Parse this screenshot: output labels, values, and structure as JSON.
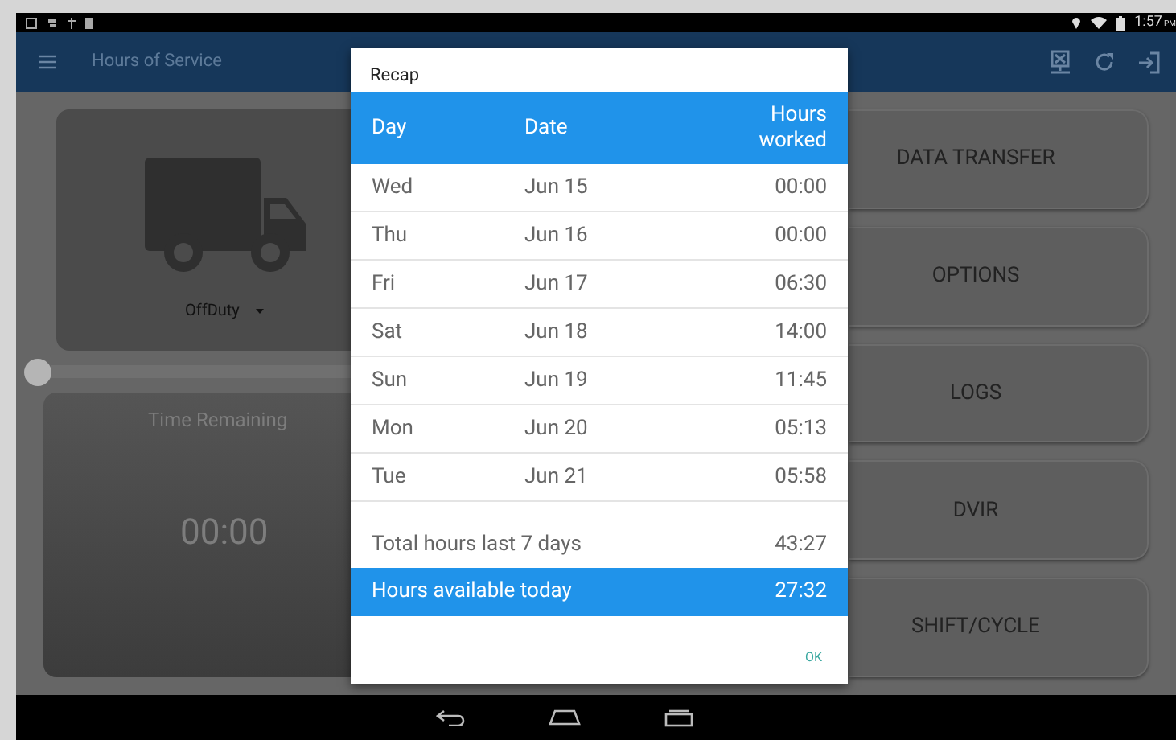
{
  "status_bar": {
    "time": "1:57",
    "ampm": "PM"
  },
  "app_bar": {
    "title": "Hours of Service"
  },
  "status_card": {
    "status": "OffDuty"
  },
  "time_card": {
    "label": "Time Remaining",
    "value": "00:00"
  },
  "menu_buttons": [
    "DATA TRANSFER",
    "OPTIONS",
    "LOGS",
    "DVIR",
    "SHIFT/CYCLE"
  ],
  "dialog": {
    "title": "Recap",
    "columns": [
      "Day",
      "Date",
      "Hours worked"
    ],
    "rows": [
      {
        "day": "Wed",
        "date": "Jun 15",
        "hours": "00:00"
      },
      {
        "day": "Thu",
        "date": "Jun 16",
        "hours": "00:00"
      },
      {
        "day": "Fri",
        "date": "Jun 17",
        "hours": "06:30"
      },
      {
        "day": "Sat",
        "date": "Jun 18",
        "hours": "14:00"
      },
      {
        "day": "Sun",
        "date": "Jun 19",
        "hours": "11:45"
      },
      {
        "day": "Mon",
        "date": "Jun 20",
        "hours": "05:13"
      },
      {
        "day": "Tue",
        "date": "Jun 21",
        "hours": "05:58"
      }
    ],
    "total": {
      "label": "Total hours last 7 days",
      "value": "43:27"
    },
    "available": {
      "label": "Hours available today",
      "value": "27:32"
    },
    "button": "OK"
  }
}
